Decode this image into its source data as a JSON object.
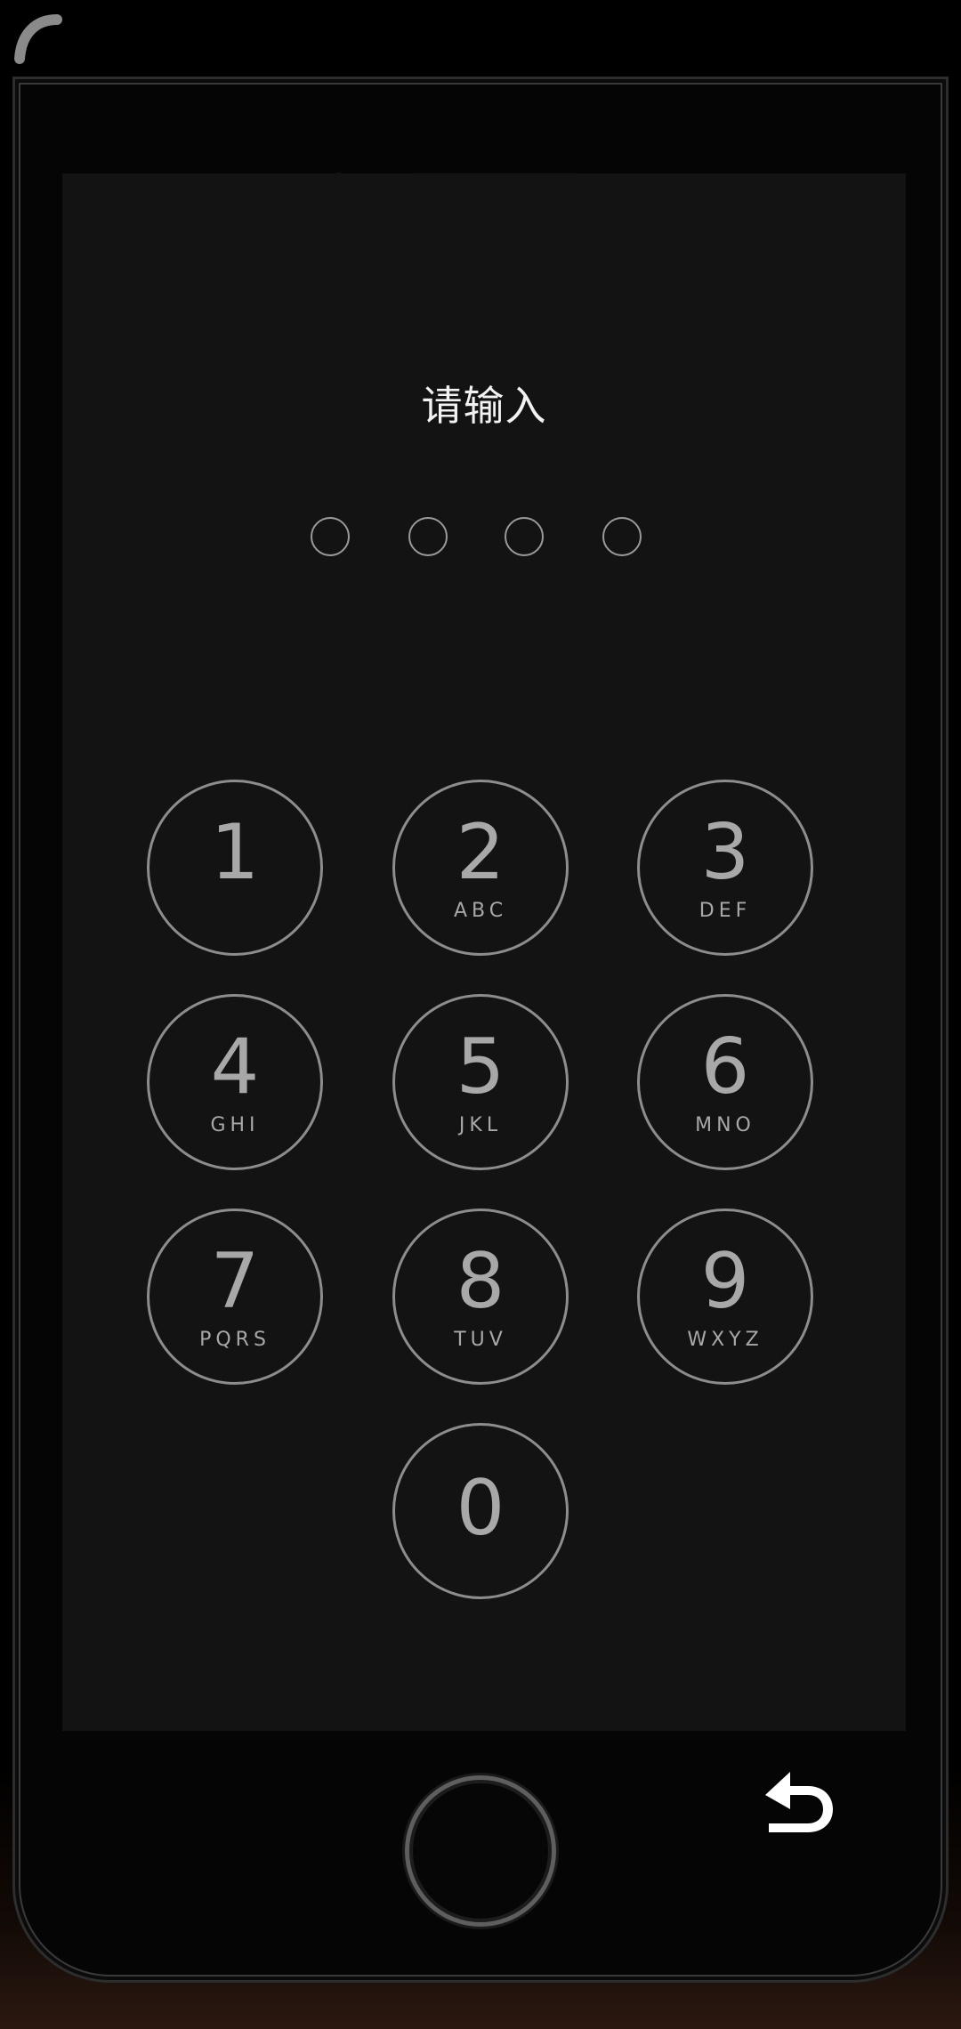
{
  "screen": {
    "title": "请输入",
    "passcode_length": 4
  },
  "keypad": {
    "keys": [
      {
        "digit": "1",
        "letters": ""
      },
      {
        "digit": "2",
        "letters": "ABC"
      },
      {
        "digit": "3",
        "letters": "DEF"
      },
      {
        "digit": "4",
        "letters": "GHI"
      },
      {
        "digit": "5",
        "letters": "JKL"
      },
      {
        "digit": "6",
        "letters": "MNO"
      },
      {
        "digit": "7",
        "letters": "PQRS"
      },
      {
        "digit": "8",
        "letters": "TUV"
      },
      {
        "digit": "9",
        "letters": "WXYZ"
      },
      {
        "digit": "0",
        "letters": ""
      }
    ]
  },
  "icons": {
    "corner": "curved-grip-icon",
    "back": "back-arrow-icon",
    "home": "home-button-icon"
  },
  "colors": {
    "screen_bg": "#131313",
    "key_border": "#8d8d8d",
    "key_text": "#a8a8a8",
    "title_text": "#f2f2f2",
    "back_icon": "#ffffff"
  }
}
